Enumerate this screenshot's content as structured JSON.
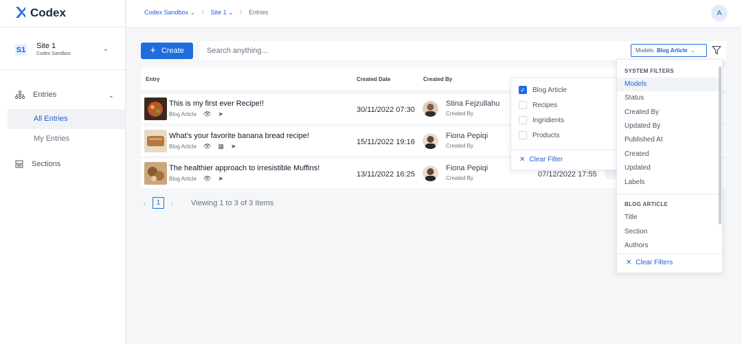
{
  "app": {
    "name": "Codex"
  },
  "site": {
    "badge": "S1",
    "name": "Site 1",
    "org": "Codex Sandbox"
  },
  "nav": {
    "entries": "Entries",
    "all_entries": "All Entries",
    "my_entries": "My Entries",
    "sections": "Sections"
  },
  "breadcrumb": {
    "org": "Codex Sandbox",
    "site": "Site 1",
    "current": "Entries",
    "sep": "/"
  },
  "user": {
    "initial": "A"
  },
  "toolbar": {
    "create_label": "Create",
    "search_placeholder": "Search anything...",
    "model_label": "Models:",
    "model_value": "Blog Article"
  },
  "table": {
    "headers": {
      "entry": "Entry",
      "created_date": "Created Date",
      "created_by": "Created By"
    },
    "rows": [
      {
        "title": "This is my first ever Recipe!!",
        "model": "Blog Article",
        "date": "30/11/2022 07:30",
        "author": "Stina Fejzullahu",
        "role": "Created By",
        "extra": ""
      },
      {
        "title": "What's your favorite banana bread recipe!",
        "model": "Blog Article",
        "date": "15/11/2022 19:16",
        "author": "Fiona Pepiqi",
        "role": "Created By",
        "extra": ""
      },
      {
        "title": "The healthier approach to irresistible Muffins!",
        "model": "Blog Article",
        "date": "13/11/2022 16:25",
        "author": "Fiona Pepiqi",
        "role": "Created By",
        "extra": "07/12/2022 17:55"
      }
    ]
  },
  "pagination": {
    "page": "1",
    "info": "Viewing 1 to 3 of 3 Items"
  },
  "model_filter": {
    "options": [
      {
        "label": "Blog Article",
        "checked": true
      },
      {
        "label": "Recipes",
        "checked": false
      },
      {
        "label": "Ingridients",
        "checked": false
      },
      {
        "label": "Products",
        "checked": false
      }
    ],
    "clear_label": "Clear Filter"
  },
  "filters": {
    "system_heading": "SYSTEM FILTERS",
    "system_items": [
      "Models",
      "Status",
      "Created By",
      "Updated By",
      "Published At",
      "Created",
      "Updated",
      "Labels"
    ],
    "blog_heading": "BLOG ARTICLE",
    "blog_items": [
      "Title",
      "Section",
      "Authors"
    ],
    "clear_label": "Clear Filters"
  },
  "colors": {
    "accent": "#1f6ce0",
    "link": "#1f5fd6"
  },
  "icons": {
    "eye": "eye-icon",
    "rocket": "rocket-icon",
    "calendar": "calendar-icon",
    "filter": "filter-icon"
  }
}
